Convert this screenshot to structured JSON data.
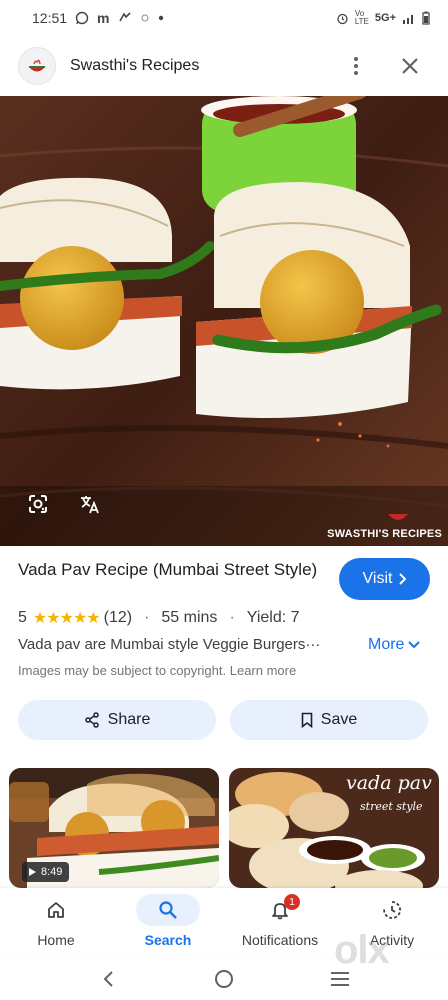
{
  "status_bar": {
    "time": "12:51",
    "left_icons": [
      "whatsapp-icon",
      "gmail-icon",
      "app-icon",
      "notification-icon"
    ],
    "network": "5G+",
    "right_icons": [
      "alarm-icon",
      "wifi-calling-icon",
      "signal-icon",
      "battery-icon"
    ]
  },
  "header": {
    "site_name": "Swasthi's Recipes"
  },
  "image": {
    "watermark": "SWASTHI'S RECIPES"
  },
  "result": {
    "title": "Vada Pav Recipe (Mumbai Street Style)",
    "visit_label": "Visit",
    "rating": "5",
    "stars": "★★★★★",
    "rating_value": 5,
    "review_count": "(12)",
    "time": "55 mins",
    "yield": "Yield: 7",
    "description": "Vada pav are Mumbai style Veggie Burgers···",
    "more_label": "More",
    "copyright_text": "Images may be subject to copyright.",
    "learn_more": "Learn more"
  },
  "actions": {
    "share_label": "Share",
    "save_label": "Save"
  },
  "related": {
    "video_duration": "8:49",
    "thumb2_title": "vada pav",
    "thumb2_subtitle": "street style"
  },
  "bottom_nav": {
    "items": [
      {
        "label": "Home",
        "icon": "home-icon"
      },
      {
        "label": "Search",
        "icon": "search-icon",
        "active": true
      },
      {
        "label": "Notifications",
        "icon": "bell-icon",
        "badge": "1"
      },
      {
        "label": "Activity",
        "icon": "activity-icon"
      }
    ]
  },
  "watermark_overlay": "olx",
  "colors": {
    "accent": "#1a73e8",
    "action_bg": "#e8f0fe",
    "star": "#f4b400",
    "badge": "#d93025"
  }
}
